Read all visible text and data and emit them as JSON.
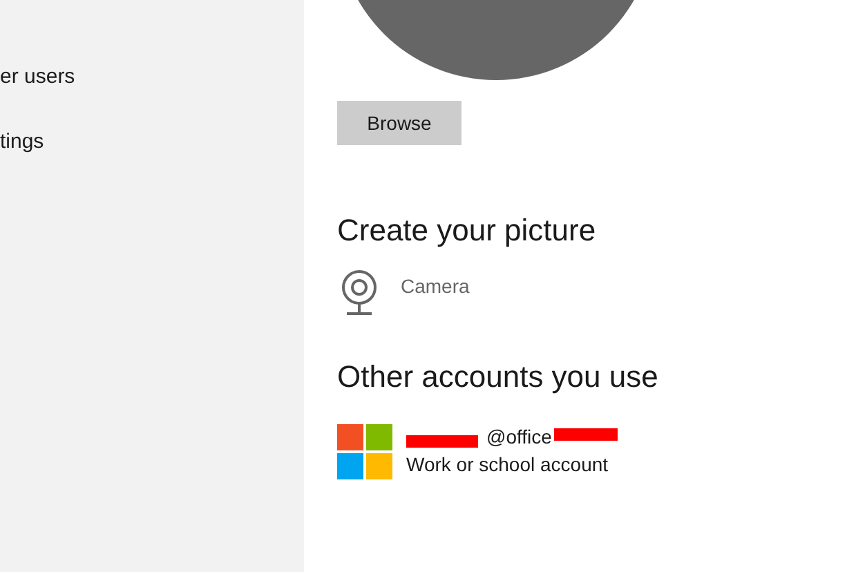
{
  "sidebar": {
    "items": [
      {
        "label": "er users"
      },
      {
        "label": "tings"
      }
    ]
  },
  "browse_button": "Browse",
  "create_picture": {
    "heading": "Create your picture",
    "options": [
      {
        "label": "Camera"
      }
    ]
  },
  "other_accounts": {
    "heading": "Other accounts you use",
    "accounts": [
      {
        "email": "@office",
        "type": "Work or school account"
      }
    ]
  }
}
